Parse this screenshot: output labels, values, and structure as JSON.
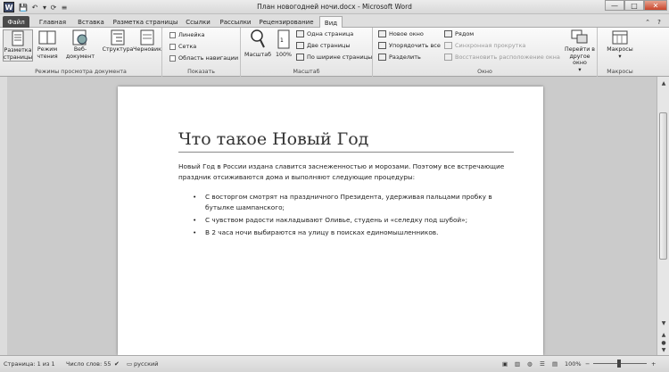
{
  "window": {
    "title": "План новогодней ночи.docx - Microsoft Word",
    "logo_letter": "W",
    "qat": [
      "💾",
      "↶",
      "▾",
      "⟳",
      "≡"
    ],
    "controls": [
      "—",
      "□",
      "✕"
    ]
  },
  "tabs": [
    {
      "label": "Файл",
      "style": "file"
    },
    {
      "label": "Главная",
      "style": "normal"
    },
    {
      "label": "Вставка",
      "style": "normal"
    },
    {
      "label": "Разметка страницы",
      "style": "normal"
    },
    {
      "label": "Ссылки",
      "style": "normal"
    },
    {
      "label": "Рассылки",
      "style": "normal"
    },
    {
      "label": "Рецензирование",
      "style": "normal"
    },
    {
      "label": "Вид",
      "style": "active"
    }
  ],
  "ribbon": {
    "groups": {
      "views": {
        "label": "Режимы просмотра документа",
        "buttons": [
          {
            "label": "Разметка страницы",
            "icon": "page-layout-icon"
          },
          {
            "label": "Режим чтения",
            "icon": "reading-mode-icon"
          },
          {
            "label": "Веб-документ",
            "icon": "web-document-icon"
          },
          {
            "label": "Структура",
            "icon": "outline-icon"
          },
          {
            "label": "Черновик",
            "icon": "draft-icon"
          }
        ]
      },
      "show": {
        "label": "Показать",
        "items": [
          "Линейка",
          "Сетка",
          "Область навигации"
        ]
      },
      "zoom": {
        "label": "Масштаб",
        "zoom_label": "Масштаб",
        "hundred_label": "100%",
        "items": [
          "Одна страница",
          "Две страницы",
          "По ширине страницы"
        ]
      },
      "window": {
        "label": "Окно",
        "left": [
          "Новое окно",
          "Упорядочить все",
          "Разделить"
        ],
        "right": [
          {
            "label": "Рядом",
            "disabled": false
          },
          {
            "label": "Синхронная прокрутка",
            "disabled": true
          },
          {
            "label": "Восстановить расположение окна",
            "disabled": true
          }
        ],
        "switch_label": "Перейти в другое окно",
        "switch_arrow": "▾"
      },
      "macros": {
        "label": "Макросы",
        "button": "Макросы",
        "button_arrow": "▾"
      }
    }
  },
  "document": {
    "title": "Что такое Новый Год",
    "paragraph": "Новый Год в России издана славится заснеженностью и морозами. Поэтому все встречающие праздник отсиживаются дома и выполняют следующие процедуры:",
    "bullet": "•",
    "bullets": [
      "С восторгом смотрят на праздничного Президента, удерживая пальцами пробку в бутылке шампанского;",
      "С чувством радости накладывают Оливье, студень и «селедку под шубой»;",
      "В 2 часа ночи выбираются на улицу в поисках единомышленников."
    ]
  },
  "status": {
    "page": "Страница: 1 из 1",
    "words": "Число слов: 55",
    "lang": "русский",
    "zoom": "100%"
  },
  "colors": {
    "file_tab": "#4a4a4a",
    "page": "#ffffff",
    "doc_bg": "#cbcbcb"
  }
}
